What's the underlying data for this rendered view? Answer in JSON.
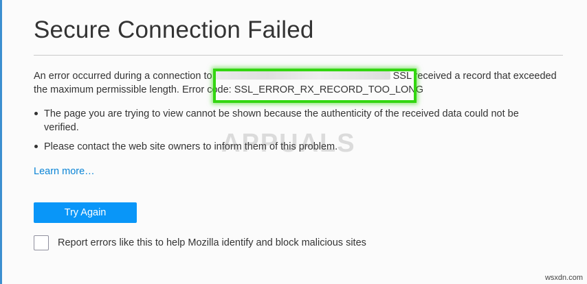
{
  "page": {
    "title": "Secure Connection Failed"
  },
  "error": {
    "line1_prefix": "An error occurred during a connection to",
    "line1_suffix": "SSL received a record that exceeded",
    "line2": "the maximum permissible length. Error code: SSL_ERROR_RX_RECORD_TOO_LONG"
  },
  "bullets": [
    "The page you are trying to view cannot be shown because the authenticity of the received data could not be verified.",
    "Please contact the web site owners to inform them of this problem."
  ],
  "learn_more": "Learn more…",
  "try_again": "Try Again",
  "report": {
    "label": "Report errors like this to help Mozilla identify and block malicious sites",
    "checked": false
  },
  "watermark": "APPUALS",
  "site_credit": "wsxdn.com",
  "colors": {
    "accent": "#0996f8",
    "link": "#0a84d6",
    "highlight": "#33d611",
    "left_rule": "#3c8fd0"
  }
}
